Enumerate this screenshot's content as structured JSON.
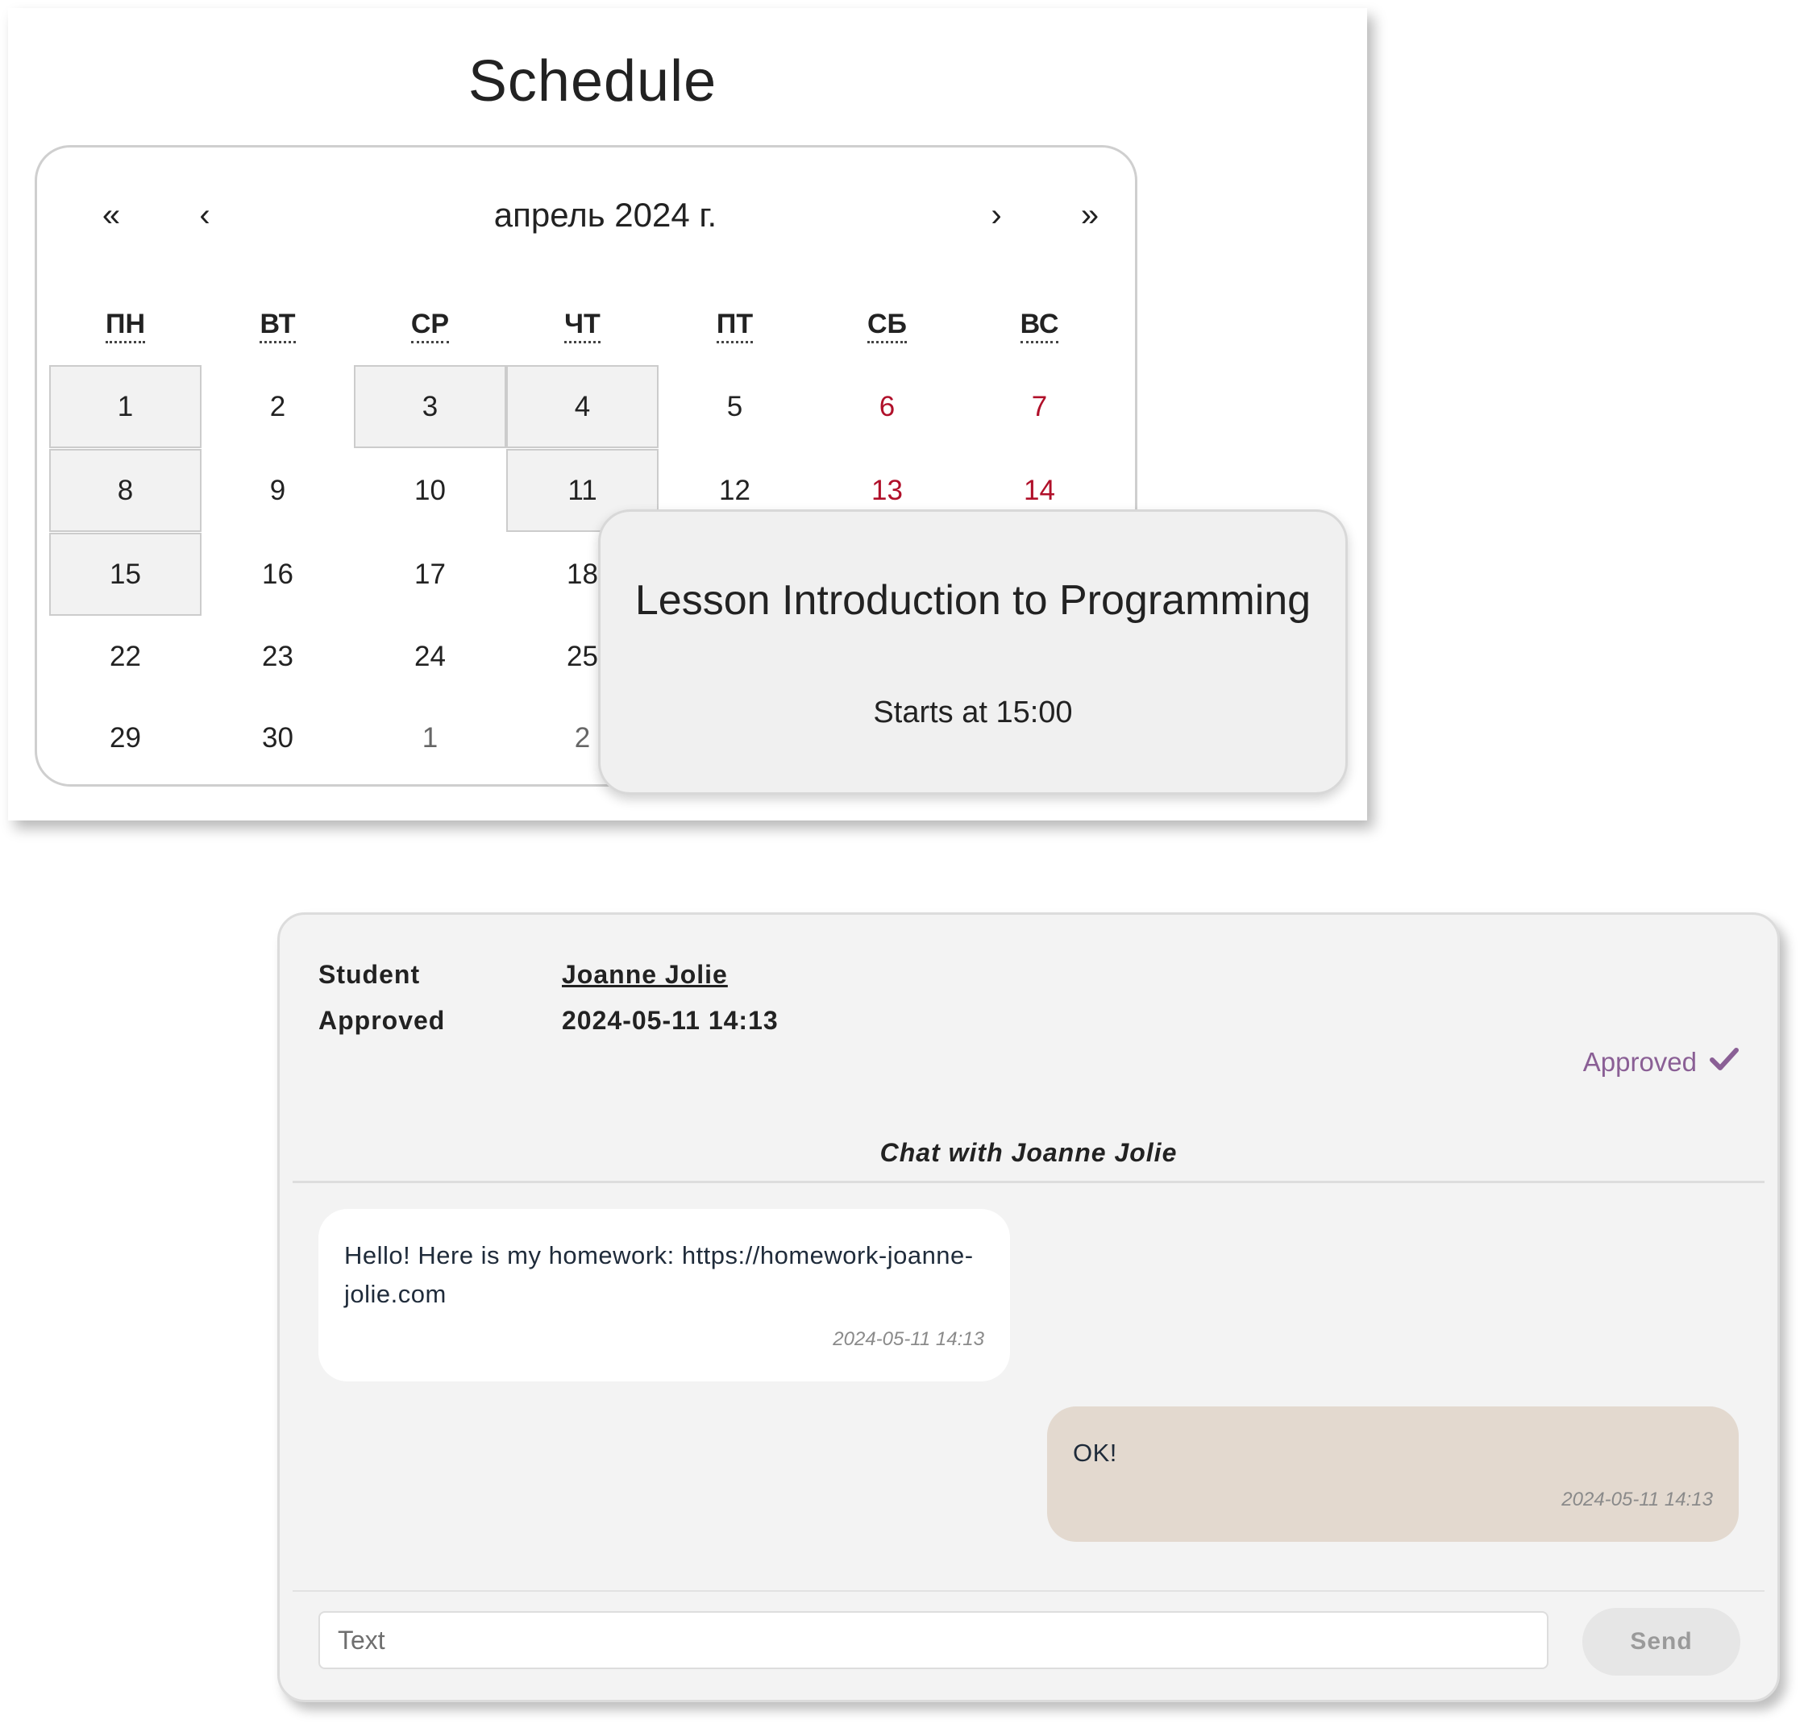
{
  "schedule": {
    "title": "Schedule",
    "calendar": {
      "nav": {
        "prev_year": "«",
        "prev_month": "‹",
        "next_month": "›",
        "next_year": "»"
      },
      "month_label": "апрель 2024 г.",
      "weekdays": [
        "ПН",
        "ВТ",
        "СР",
        "ЧТ",
        "ПТ",
        "СБ",
        "ВС"
      ],
      "weeks": [
        [
          "1",
          "2",
          "3",
          "4",
          "5",
          "6",
          "7"
        ],
        [
          "8",
          "9",
          "10",
          "11",
          "12",
          "13",
          "14"
        ],
        [
          "15",
          "16",
          "17",
          "18",
          "",
          "",
          ""
        ],
        [
          "22",
          "23",
          "24",
          "25",
          "",
          "",
          ""
        ],
        [
          "29",
          "30",
          "1",
          "2",
          "",
          "",
          ""
        ]
      ]
    },
    "popup": {
      "title": "Lesson Introduction to Programming",
      "time": "Starts at 15:00"
    }
  },
  "chat_panel": {
    "student_label": "Student",
    "student_name": "Joanne Jolie",
    "approved_label": "Approved",
    "approved_datetime": "2024-05-11 14:13",
    "status_text": "Approved",
    "status_icon": "checkmark-icon",
    "status_color": "#8a5f95",
    "chat_title": "Chat with Joanne Jolie",
    "messages": [
      {
        "text": "Hello! Here is my homework: https://homework-joanne-jolie.com",
        "time": "2024-05-11 14:13"
      },
      {
        "text": "OK!",
        "time": "2024-05-11 14:13"
      }
    ],
    "input_placeholder": "Text",
    "send_label": "Send"
  }
}
